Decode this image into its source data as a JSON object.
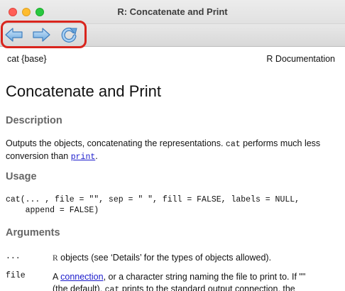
{
  "window": {
    "title": "R: Concatenate and Print"
  },
  "toolbar": {
    "back_icon": "back-arrow-icon",
    "forward_icon": "forward-arrow-icon",
    "reload_icon": "reload-icon",
    "highlight_color": "#d9251d"
  },
  "doc": {
    "header_left": "cat {base}",
    "header_right": "R Documentation",
    "title": "Concatenate and Print",
    "description_heading": "Description",
    "description_before_code": "Outputs the objects, concatenating the representations. ",
    "description_code": "cat",
    "description_middle": " performs much less conversion than ",
    "description_link": "print",
    "description_end": ".",
    "usage_heading": "Usage",
    "usage_line1": "cat(... , file = \"\", sep = \" \", fill = FALSE, labels = NULL,",
    "usage_line2": "    append = FALSE)",
    "arguments_heading": "Arguments",
    "args": [
      {
        "name": "...",
        "desc_symbol": "R",
        "desc": " objects (see ‘Details’ for the types of objects allowed)."
      },
      {
        "name": "file",
        "desc_before_link": "A ",
        "desc_link": "connection",
        "desc_after_link": ", or a character string naming the file to print to. If \"\"",
        "desc_line2_start": "(the default), ",
        "desc_line2_code": "cat",
        "desc_line2_end": " prints to the standard output connection, the"
      }
    ]
  }
}
